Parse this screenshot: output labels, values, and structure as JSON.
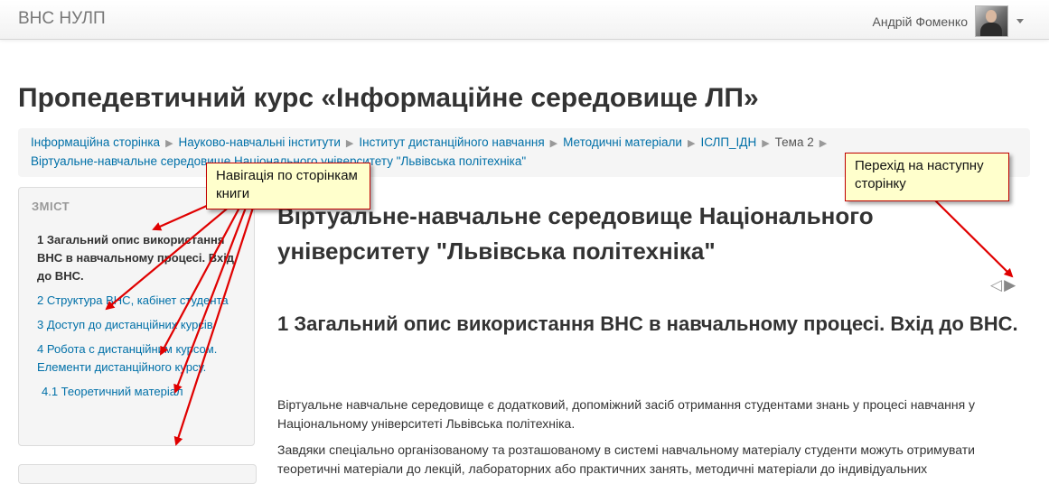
{
  "navbar": {
    "brand": "ВНС НУЛП",
    "user_name": "Андрій Фоменко"
  },
  "page_title": "Пропедевтичний курс «Інформаційне середовище ЛП»",
  "breadcrumb": {
    "items": [
      "Інформаційна сторінка",
      "Науково-навчальні інститути",
      "Інститут дистанційного навчання",
      "Методичні матеріали",
      "ІСЛП_ІДН",
      "Тема 2",
      "Віртуальне-навчальне середовище Національного університету \"Львівська політехніка\""
    ]
  },
  "toc": {
    "title": "ЗМІСТ",
    "items": [
      "1 Загальний опис використання ВНС в навчальному процесі. Вхід до ВНС.",
      "2 Структура ВНС, кабінет студента",
      "3 Доступ до дистанційних курсів",
      "4 Робота с дистанційним курсом. Елементи дистанційного курсу.",
      "4.1 Теоретичний матеріал"
    ]
  },
  "book": {
    "title": "Віртуальне-навчальне середовище Національного університету \"Львівська політехніка\"",
    "prev_arrow": "◁",
    "next_arrow": "▶",
    "chapter_title": "1 Загальний опис використання ВНС в навчальному процесі. Вхід до ВНС.",
    "paragraph1": "Віртуальне навчальне середовище є додатковий, допоміжний засіб отримання студентами знань у процесі навчання у Національному університеті Львівська політехніка.",
    "paragraph2": "Завдяки спеціально організованому та розташованому в системі навчальному матеріалу студенти можуть отримувати теоретичні матеріали до лекцій, лабораторних або практичних занять, методичні матеріали до індивідуальних"
  },
  "annotations": {
    "callout1": "Навігація по сторінкам книги",
    "callout2": "Перехід на наступну сторінку"
  },
  "colors": {
    "link": "#0070a8",
    "annotation_border": "#c00000",
    "annotation_fill": "#ffffcc"
  }
}
